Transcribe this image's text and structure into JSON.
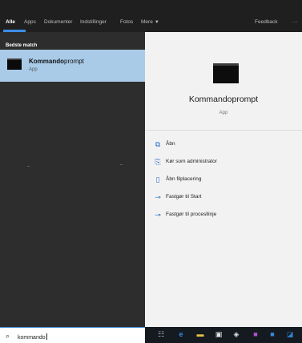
{
  "filter_tabs": [
    {
      "label": "Alle",
      "active": true
    },
    {
      "label": "Apps"
    },
    {
      "label": "Dokumenter"
    },
    {
      "label": "Indstillinger"
    },
    {
      "label": "Fotos"
    },
    {
      "label": "Mere"
    }
  ],
  "feedback_label": "Feedback",
  "overflow_label": "···",
  "results": {
    "section_title": "Bedste match",
    "best_match": {
      "name_bold": "Kommando",
      "name_rest": "prompt",
      "type": "App",
      "icon": "command-prompt-icon"
    }
  },
  "detail": {
    "title": "Kommandoprompt",
    "type": "App",
    "icon": "command-prompt-icon",
    "actions": [
      {
        "label": "Åbn",
        "icon": "open-icon"
      },
      {
        "label": "Kør som administrator",
        "icon": "run-as-admin-icon"
      },
      {
        "label": "Åbn filplacering",
        "icon": "file-location-icon"
      },
      {
        "label": "Fastgør til Start",
        "icon": "pin-icon"
      },
      {
        "label": "Fastgør til procesllinje",
        "icon": "pin-icon"
      }
    ]
  },
  "search": {
    "value": "kommando",
    "icon": "search-icon"
  },
  "taskbar": {
    "icons": [
      "task-view-icon",
      "edge-icon",
      "file-explorer-icon",
      "store-icon",
      "app-icon",
      "app-icon",
      "app-icon",
      "app-icon"
    ]
  },
  "colors": {
    "topbar": "#1f1f1f",
    "results_panel": "#2d2d2d",
    "selection": "#a9cbe8",
    "detail_panel": "#f2f2f2",
    "accent": "#3a8ee6"
  }
}
